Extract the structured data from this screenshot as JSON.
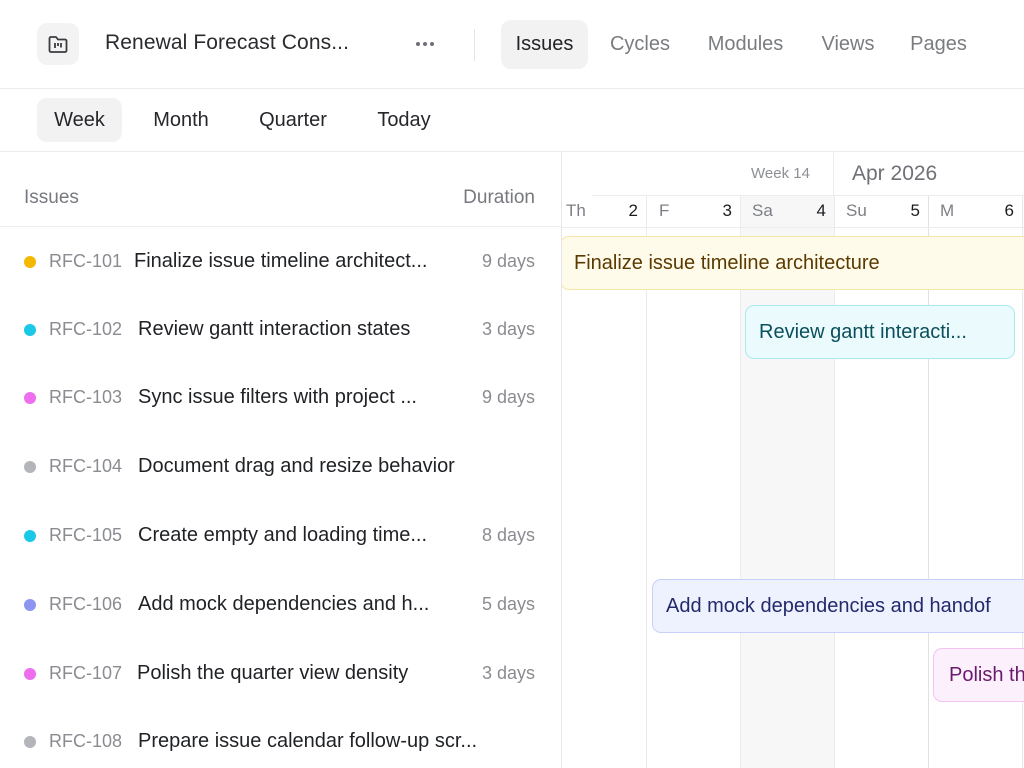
{
  "header": {
    "project_icon": "project-board-icon",
    "project_title": "Renewal Forecast Cons...",
    "more_icon": "more-horizontal-icon",
    "tabs": [
      {
        "label": "Issues",
        "active": true
      },
      {
        "label": "Cycles",
        "active": false
      },
      {
        "label": "Modules",
        "active": false
      },
      {
        "label": "Views",
        "active": false
      },
      {
        "label": "Pages",
        "active": false
      }
    ]
  },
  "toolbar": {
    "ranges": [
      {
        "label": "Week",
        "active": true
      },
      {
        "label": "Month",
        "active": false
      },
      {
        "label": "Quarter",
        "active": false
      },
      {
        "label": "Today",
        "active": false
      }
    ]
  },
  "list": {
    "header_issues": "Issues",
    "header_duration": "Duration",
    "rows": [
      {
        "id": "RFC-101",
        "title": "Finalize issue timeline architect...",
        "duration": "9 days",
        "color": "#f5b800"
      },
      {
        "id": "RFC-102",
        "title": "Review gantt interaction states",
        "duration": "3 days",
        "color": "#1cc8e8"
      },
      {
        "id": "RFC-103",
        "title": "Sync issue filters with project ...",
        "duration": "9 days",
        "color": "#ee6ef0"
      },
      {
        "id": "RFC-104",
        "title": "Document drag and resize behavior",
        "duration": "",
        "color": "#b3b5ba"
      },
      {
        "id": "RFC-105",
        "title": "Create empty and loading time...",
        "duration": "8 days",
        "color": "#1cc8e8"
      },
      {
        "id": "RFC-106",
        "title": "Add mock dependencies and h...",
        "duration": "5 days",
        "color": "#8c95f2"
      },
      {
        "id": "RFC-107",
        "title": "Polish the quarter view density",
        "duration": "3 days",
        "color": "#ee6ef0"
      },
      {
        "id": "RFC-108",
        "title": "Prepare issue calendar follow-up scr...",
        "duration": "",
        "color": "#b3b5ba"
      }
    ]
  },
  "timeline": {
    "week_label": "Week 14",
    "month_label": "Apr 2026",
    "days": [
      {
        "letter": "Th",
        "num": "2"
      },
      {
        "letter": "F",
        "num": "3"
      },
      {
        "letter": "Sa",
        "num": "4"
      },
      {
        "letter": "Su",
        "num": "5"
      },
      {
        "letter": "M",
        "num": "6"
      }
    ],
    "bars": [
      {
        "label": "Finalize issue timeline architecture",
        "bg": "#fffbea",
        "border": "#f6e7a8",
        "fg": "#5a3a00"
      },
      {
        "label": "Review gantt interacti...",
        "bg": "#ebfbfd",
        "border": "#a8e9f2",
        "fg": "#0b4f5c"
      },
      {
        "label": "Add mock dependencies and handof",
        "bg": "#eef1fe",
        "border": "#c9cffb",
        "fg": "#232a6b"
      },
      {
        "label": "Polish th",
        "bg": "#fdf0fd",
        "border": "#f2c3f3",
        "fg": "#6a1a6c"
      }
    ]
  }
}
